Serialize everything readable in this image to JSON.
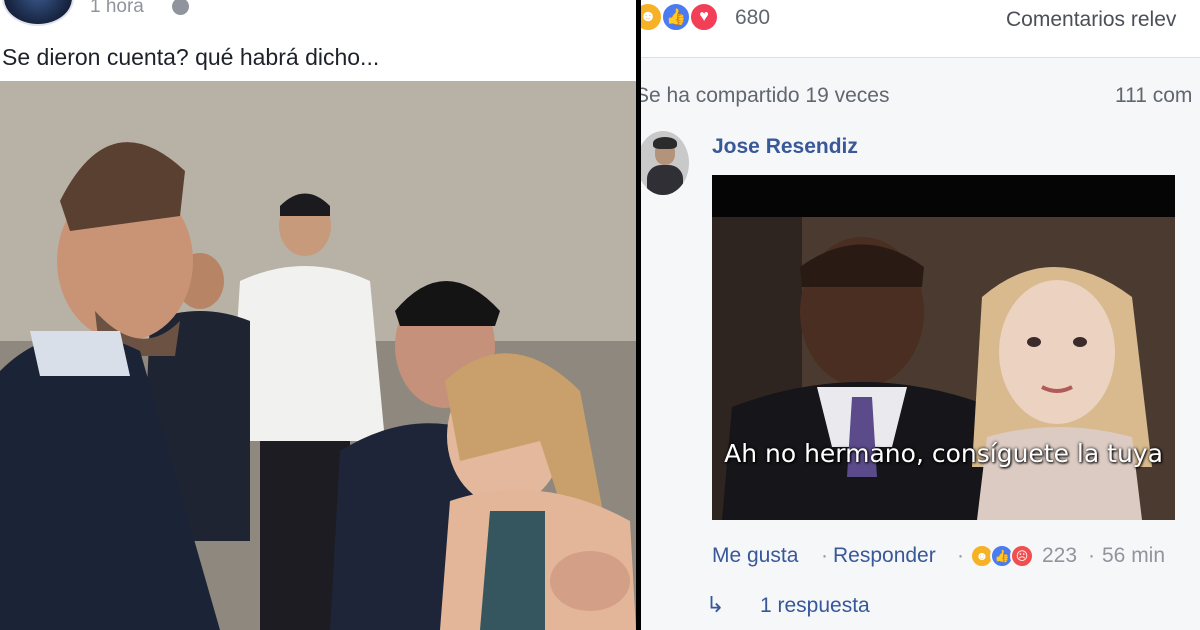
{
  "post": {
    "time": "1 hora",
    "text": "Se dieron cuenta? qué habrá dicho..."
  },
  "reactions": {
    "icons": [
      "haha-icon",
      "like-icon",
      "love-icon"
    ],
    "count": "680",
    "sort_label": "Comentarios relev"
  },
  "stats": {
    "shares": "Se ha compartido 19 veces",
    "comments": "111 com"
  },
  "comment": {
    "author": "Jose Resendiz",
    "gif_caption": "Ah no hermano, consíguete la tuya",
    "like_label": "Me gusta",
    "reply_label": "Responder",
    "separator": "·",
    "reaction_icons": [
      "haha-icon",
      "like-icon",
      "angry-icon"
    ],
    "reaction_count": "223",
    "time": "56 min",
    "replies": "1 respuesta"
  },
  "colors": {
    "link": "#385898",
    "muted": "#90949c",
    "haha": "#f7b125",
    "like": "#4a7bf0",
    "love": "#f33e58"
  }
}
